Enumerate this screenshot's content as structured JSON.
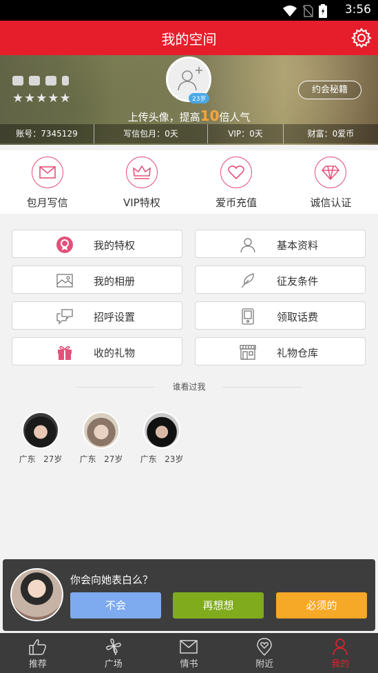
{
  "status_bar": {
    "time": "3:56"
  },
  "header": {
    "title": "我的空间",
    "settings_icon": "gear-icon"
  },
  "profile": {
    "age_badge": "23岁",
    "upload_prefix": "上传头像，提高",
    "upload_multiplier": "10",
    "upload_suffix": "倍人气",
    "date_button": "约会秘籍",
    "stars": "★★★★★",
    "stats": [
      "账号：7345129",
      "写信包月：0天",
      "VIP：0天",
      "财富：0爱币"
    ]
  },
  "quick_actions": [
    {
      "label": "包月写信",
      "icon": "envelope-icon"
    },
    {
      "label": "VIP特权",
      "icon": "crown-icon"
    },
    {
      "label": "爱币充值",
      "icon": "heart-icon"
    },
    {
      "label": "诚信认证",
      "icon": "diamond-icon"
    }
  ],
  "menu": [
    {
      "label": "我的特权",
      "icon": "badge-icon"
    },
    {
      "label": "基本资料",
      "icon": "person-icon"
    },
    {
      "label": "我的相册",
      "icon": "photo-icon"
    },
    {
      "label": "征友条件",
      "icon": "feather-icon"
    },
    {
      "label": "招呼设置",
      "icon": "chat-bubbles-icon"
    },
    {
      "label": "领取话费",
      "icon": "phone-icon"
    },
    {
      "label": "收的礼物",
      "icon": "gift-icon"
    },
    {
      "label": "礼物仓库",
      "icon": "store-icon"
    }
  ],
  "seen_me": {
    "title": "谁看过我",
    "visitors": [
      {
        "region": "广东",
        "age": "27岁"
      },
      {
        "region": "广东",
        "age": "27岁"
      },
      {
        "region": "广东",
        "age": "23岁"
      }
    ]
  },
  "popup": {
    "question": "你会向她表白么？",
    "buttons": [
      "不会",
      "再想想",
      "必须的"
    ],
    "button_colors": [
      "#7eaaf0",
      "#7fab1c",
      "#f6a827"
    ]
  },
  "tabs": [
    {
      "label": "推荐",
      "icon": "thumbs-up-icon"
    },
    {
      "label": "广场",
      "icon": "clover-icon"
    },
    {
      "label": "情书",
      "icon": "mail-icon"
    },
    {
      "label": "附近",
      "icon": "location-pin-icon"
    },
    {
      "label": "我的",
      "icon": "person-icon",
      "active": true
    }
  ],
  "colors": {
    "brand_red": "#e61e2b",
    "accent_pink": "#e5507a",
    "popup_bg": "#3d3d3d",
    "tabbar_bg": "#3b3b3b"
  }
}
